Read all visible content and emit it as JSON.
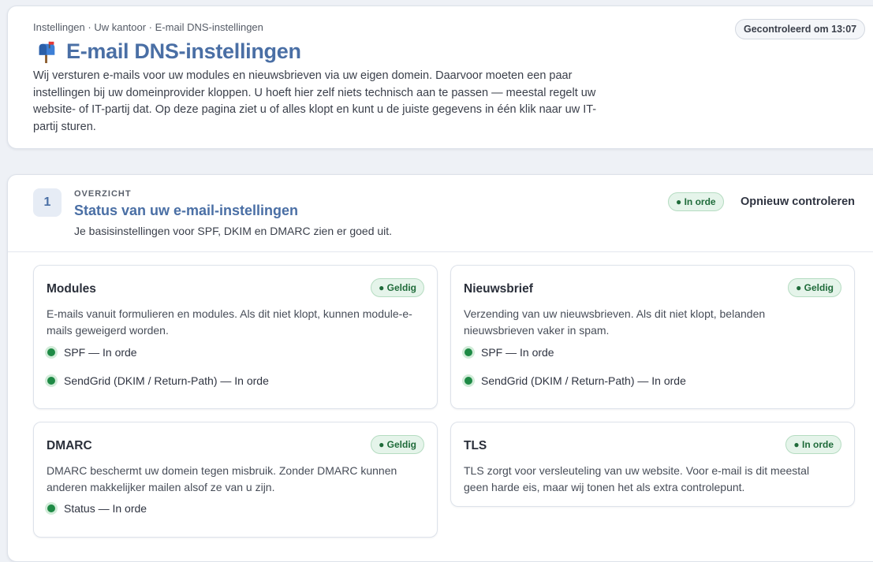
{
  "header": {
    "breadcrumb": "Instellingen · Uw kantoor · E-mail DNS-instellingen",
    "checked_badge": "Gecontroleerd om 13:07",
    "title_icon": "mailbox-icon",
    "title": "E-mail DNS-instellingen",
    "intro": "Wij versturen e-mails voor uw modules en nieuwsbrieven via uw eigen domein. Daarvoor moeten een paar instellingen bij uw domeinprovider kloppen. U hoeft hier zelf niets technisch aan te passen — meestal regelt uw website- of IT-partij dat. Op deze pagina ziet u of alles klopt en kunt u de juiste gegevens in één klik naar uw IT-partij sturen."
  },
  "overview": {
    "step": "1",
    "overline": "OVERZICHT",
    "title": "Status van uw e-mail-instellingen",
    "subtitle": "Je basisinstellingen voor SPF, DKIM en DMARC zien er goed uit.",
    "status": "● In orde",
    "recheck_label": "Opnieuw controleren",
    "cards": {
      "modules": {
        "title": "Modules",
        "status": "● Geldig",
        "description": "E-mails vanuit formulieren en modules. Als dit niet klopt, kunnen module-e-mails geweigerd worden.",
        "checks": [
          "SPF — In orde",
          "SendGrid (DKIM / Return-Path) — In orde"
        ]
      },
      "newsletter": {
        "title": "Nieuwsbrief",
        "status": "● Geldig",
        "description": "Verzending van uw nieuwsbrieven. Als dit niet klopt, belanden nieuwsbrieven vaker in spam.",
        "checks": [
          "SPF — In orde",
          "SendGrid (DKIM / Return-Path) — In orde"
        ]
      },
      "dmarc": {
        "title": "DMARC",
        "status": "● Geldig",
        "description": "DMARC beschermt uw domein tegen misbruik. Zonder DMARC kunnen anderen makkelijker mailen alsof ze van u zijn.",
        "checks": [
          "Status — In orde"
        ]
      },
      "tls": {
        "title": "TLS",
        "status": "● In orde",
        "description": "TLS zorgt voor versleuteling van uw website. Voor e-mail is dit meestal geen harde eis, maar wij tonen het als extra controlepunt."
      }
    }
  },
  "colors": {
    "accent": "#4a6fa5",
    "success": "#1e8a45",
    "success_bg": "#e5f4ea",
    "page_bg": "#eef1f6"
  }
}
